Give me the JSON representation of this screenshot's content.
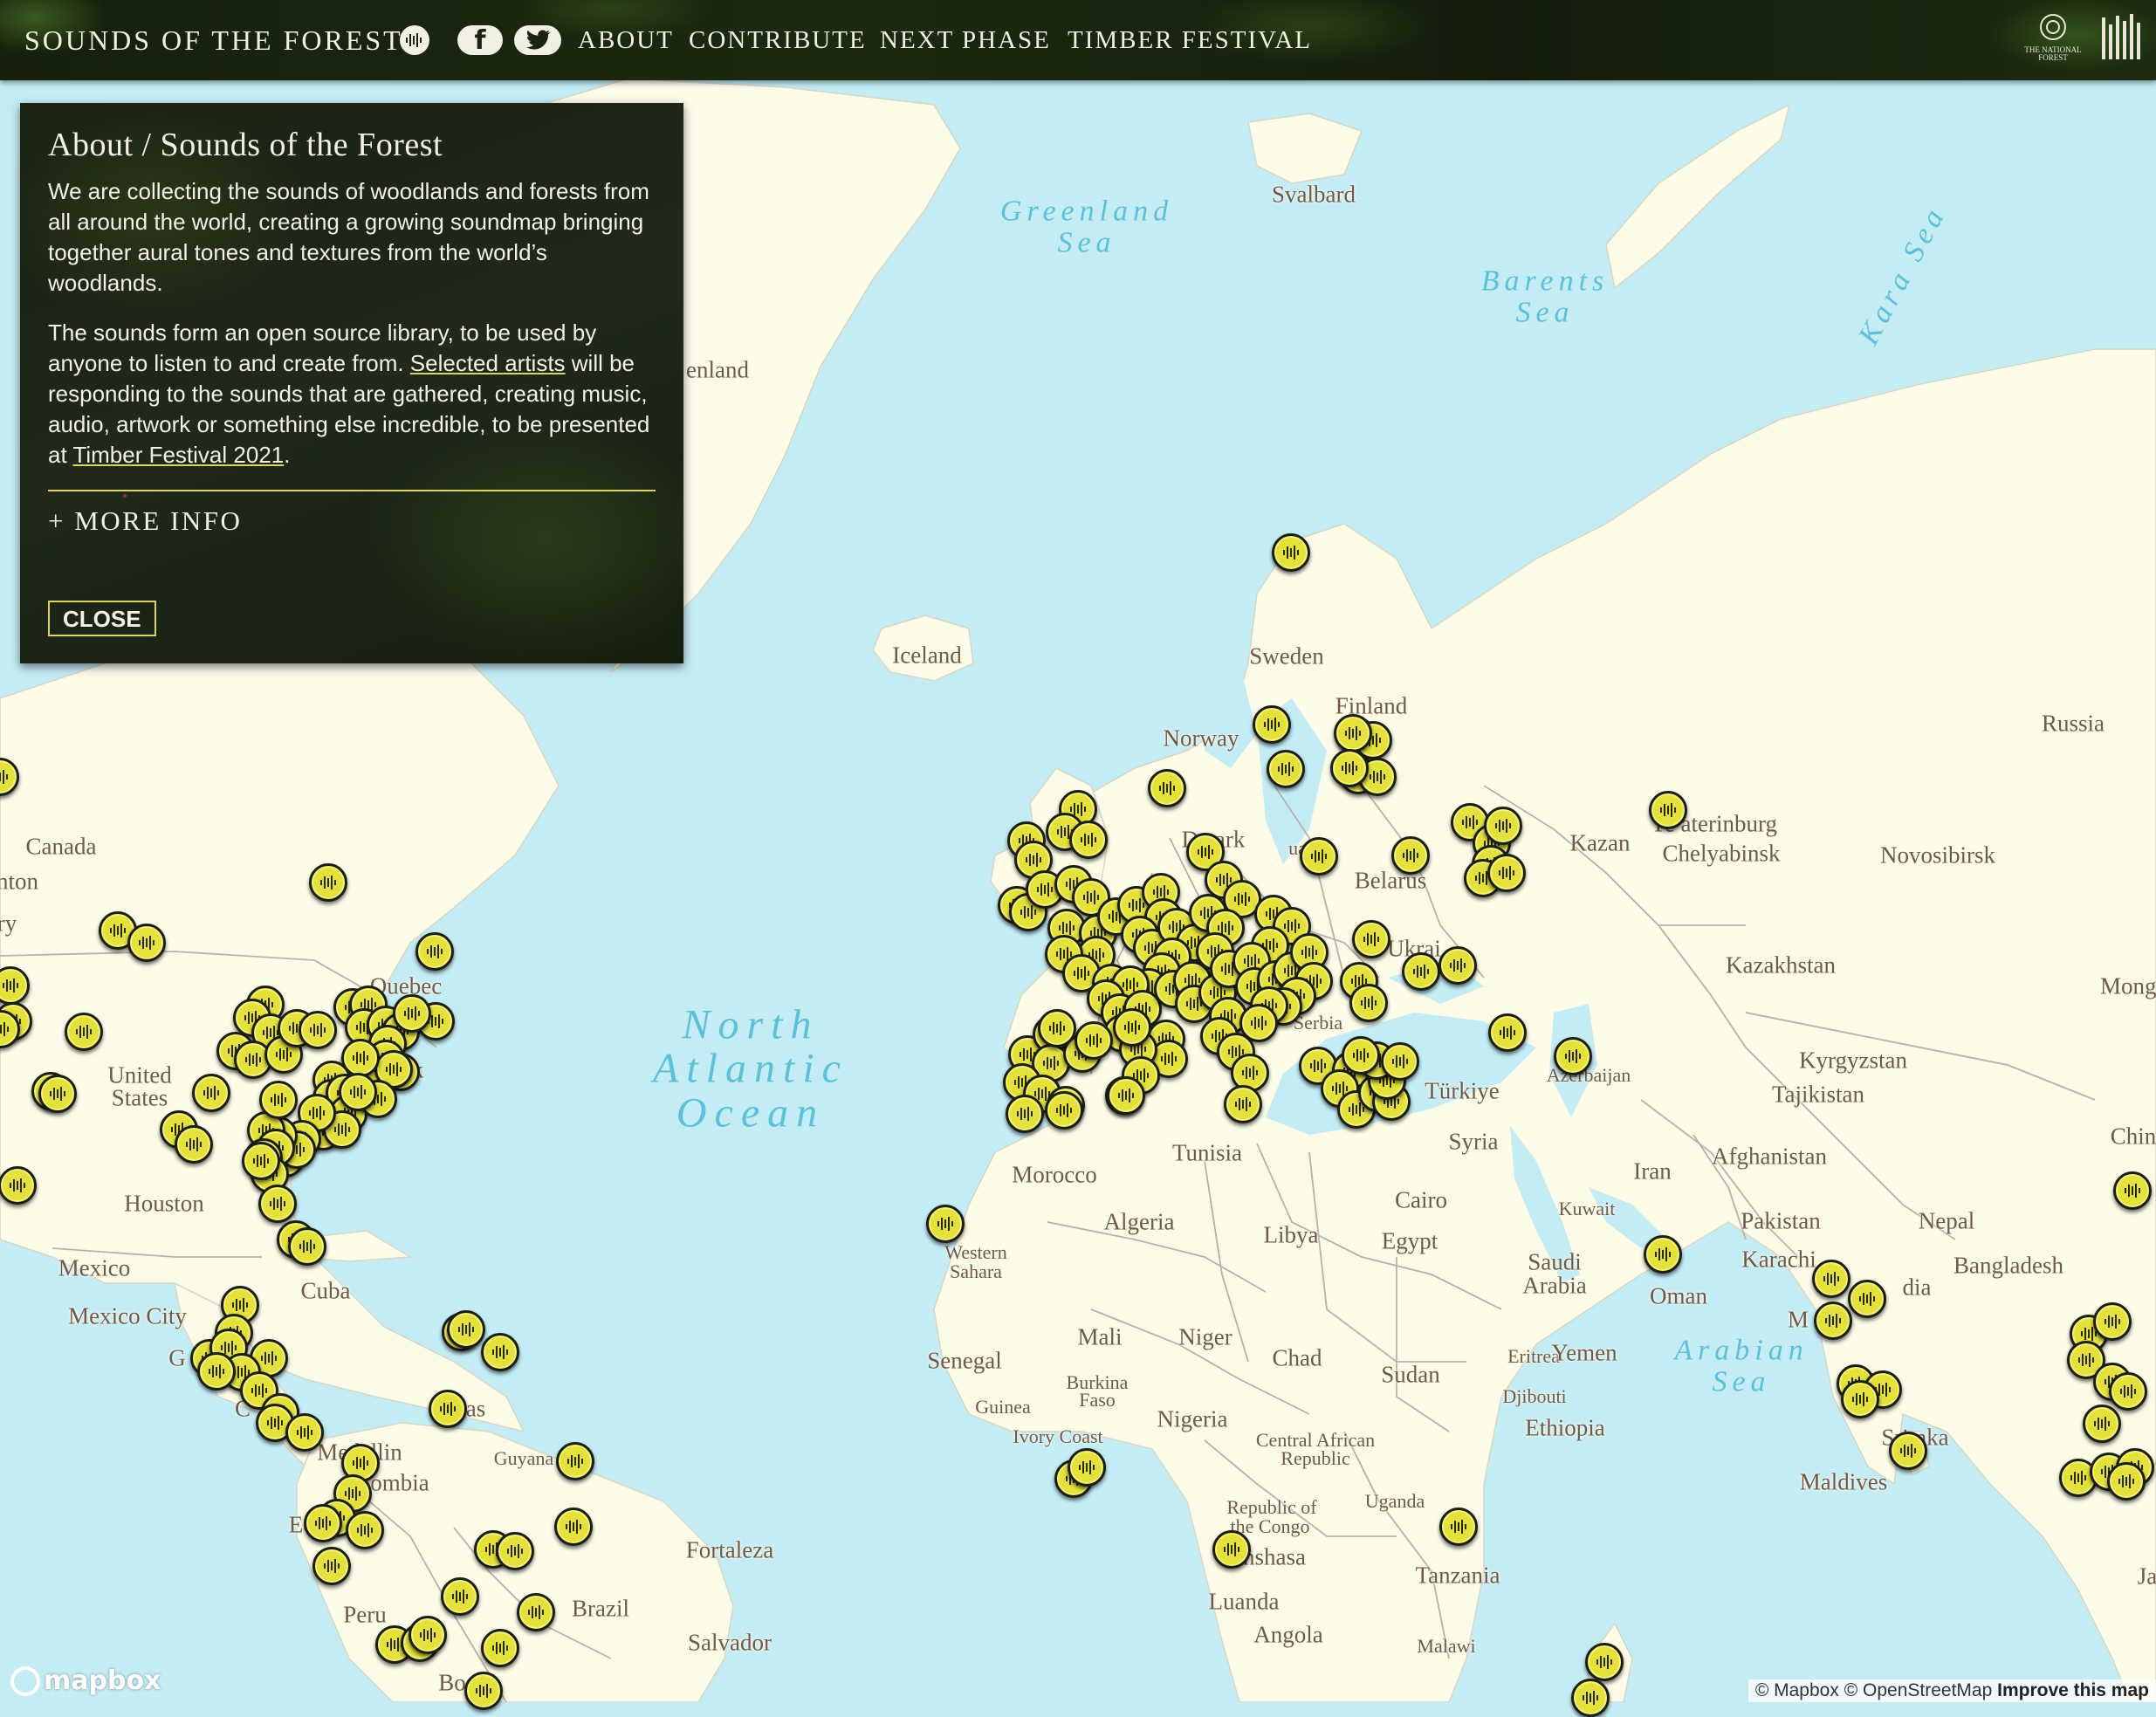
{
  "header": {
    "brand": "SOUNDS OF THE FOREST",
    "nav": [
      {
        "id": "about",
        "label": "ABOUT"
      },
      {
        "id": "contribute",
        "label": "CONTRIBUTE"
      },
      {
        "id": "next-phase",
        "label": "NEXT PHASE"
      },
      {
        "id": "timber-festival",
        "label": "TIMBER FESTIVAL"
      }
    ],
    "icons": [
      "soundmap-icon",
      "facebook-icon",
      "twitter-icon"
    ],
    "logos": [
      "national-forest-logo",
      "timber-logo"
    ],
    "logo_text": "THE NATIONAL FOREST"
  },
  "about_panel": {
    "title": "About / Sounds of the Forest",
    "para1": "We are collecting the sounds of woodlands and forests from all around the world, creating a growing soundmap bringing together aural tones and textures from the world’s woodlands.",
    "para2_a": "The sounds form an open source library, to be used by anyone to listen to and create from. ",
    "para2_link1": "Selected artists",
    "para2_b": " will be responding to the sounds that are gathered, creating music, audio, artwork or something else incredible, to be presented at ",
    "para2_link2": "Timber Festival 2021",
    "para2_c": ".",
    "more_info": "+ MORE INFO",
    "close": "CLOSE"
  },
  "map": {
    "colors": {
      "water": "#c3ecf5",
      "land": "#fbfbe8",
      "border": "#b8b2a6",
      "marker": "#e3e13a"
    },
    "labels": [
      {
        "text": "Svalbard"
      },
      {
        "text": "enland"
      },
      {
        "text": "Iceland"
      },
      {
        "text": "Sweden"
      },
      {
        "text": "Finland"
      },
      {
        "text": "Norway"
      },
      {
        "text": "De    ark"
      },
      {
        "text": "uania"
      },
      {
        "text": "Belarus"
      },
      {
        "text": "Russia"
      },
      {
        "text": "Kazan"
      },
      {
        "text": "Ye   aterinburg"
      },
      {
        "text": "Chelyabinsk"
      },
      {
        "text": "Novosibirsk"
      },
      {
        "text": "Kazakhstan"
      },
      {
        "text": "Mongo"
      },
      {
        "text": "Ukrai"
      },
      {
        "text": "Serbia"
      },
      {
        "text": "Kyrgyzstan"
      },
      {
        "text": "Tajikistan"
      },
      {
        "text": "Türkiye"
      },
      {
        "text": "Azerbaijan"
      },
      {
        "text": "Syria"
      },
      {
        "text": "Iran"
      },
      {
        "text": "Afghanistan"
      },
      {
        "text": "China"
      },
      {
        "text": "Pakistan"
      },
      {
        "text": "Nepal"
      },
      {
        "text": "Karachi"
      },
      {
        "text": "Bangladesh"
      },
      {
        "text": "Kuwait"
      },
      {
        "text": "Cairo"
      },
      {
        "text": "Egypt"
      },
      {
        "text": "Saudi"
      },
      {
        "text": "Arabia"
      },
      {
        "text": "Oman"
      },
      {
        "text": "Tunisia"
      },
      {
        "text": "Morocco"
      },
      {
        "text": "Algeria"
      },
      {
        "text": "Libya"
      },
      {
        "text": "Western"
      },
      {
        "text": "Sahara"
      },
      {
        "text": "Mali"
      },
      {
        "text": "Niger"
      },
      {
        "text": "Chad"
      },
      {
        "text": "Sudan"
      },
      {
        "text": "Eritrea"
      },
      {
        "text": "Yemen"
      },
      {
        "text": "Djibouti"
      },
      {
        "text": "Ethiopia"
      },
      {
        "text": "Senegal"
      },
      {
        "text": "Burkina"
      },
      {
        "text": "Faso"
      },
      {
        "text": "Guinea"
      },
      {
        "text": "Nigeria"
      },
      {
        "text": "Ivory Coast"
      },
      {
        "text": "Central African"
      },
      {
        "text": "Republic"
      },
      {
        "text": "Uganda"
      },
      {
        "text": "Republic of"
      },
      {
        "text": "the Congo"
      },
      {
        "text": "nshasa"
      },
      {
        "text": "Tanzania"
      },
      {
        "text": "Luanda"
      },
      {
        "text": "Angola"
      },
      {
        "text": "Malawi"
      },
      {
        "text": "Maldives"
      },
      {
        "text": "Sri    nka"
      },
      {
        "text": "M"
      },
      {
        "text": "dia"
      },
      {
        "text": "Ja"
      },
      {
        "text": "Canada"
      },
      {
        "text": "nton"
      },
      {
        "text": "ry"
      },
      {
        "text": "Quebec"
      },
      {
        "text": "rk"
      },
      {
        "text": "United"
      },
      {
        "text": "States"
      },
      {
        "text": "Houston"
      },
      {
        "text": "Mexico"
      },
      {
        "text": "Mexico City"
      },
      {
        "text": "Cuba"
      },
      {
        "text": "G"
      },
      {
        "text": "C"
      },
      {
        "text": "as"
      },
      {
        "text": "Medellin"
      },
      {
        "text": "ombia"
      },
      {
        "text": "Guyana"
      },
      {
        "text": "Ec"
      },
      {
        "text": "Peru"
      },
      {
        "text": "Brazil"
      },
      {
        "text": "Fortaleza"
      },
      {
        "text": "Salvador"
      },
      {
        "text": "Bo"
      }
    ],
    "seas": [
      {
        "text": "Greenland\nSea"
      },
      {
        "text": "Barents\nSea"
      },
      {
        "text": "Kara Sea"
      },
      {
        "text": "North\nAtlantic\nOcean"
      },
      {
        "text": "Arabian\nSea"
      }
    ]
  },
  "footer": {
    "mapbox_logo": "mapbox",
    "attribution_1": "© Mapbox",
    "attribution_2": "© OpenStreetMap",
    "attribution_3": "Improve this map"
  }
}
